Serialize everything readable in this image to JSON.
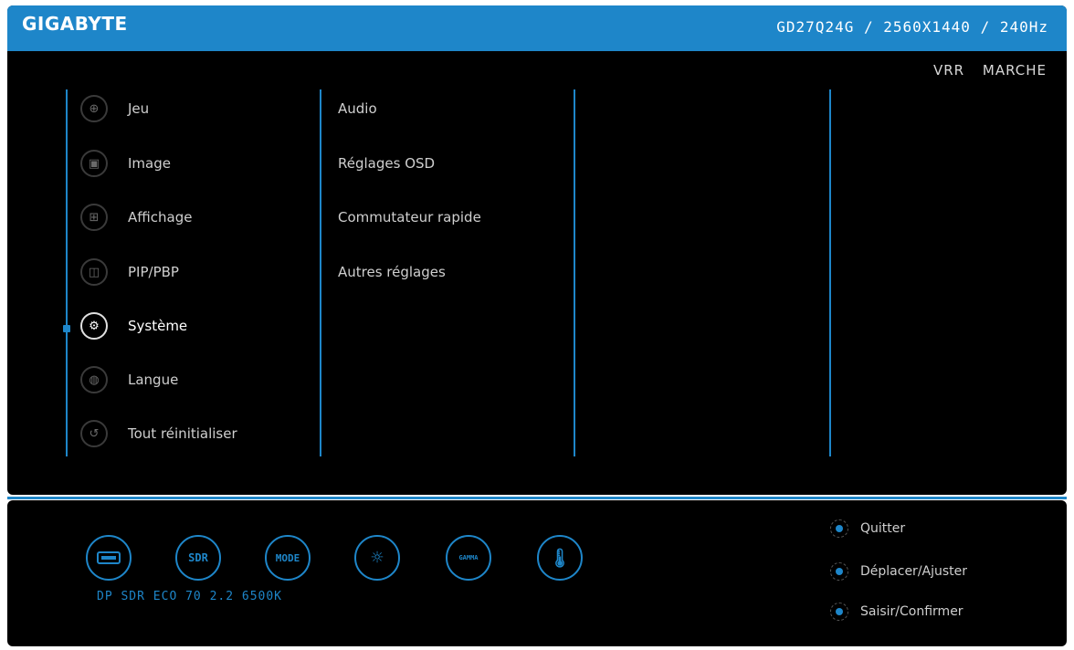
{
  "header": {
    "brand": "GIGABYTE",
    "model_info": "GD27Q24G  /  2560X1440 / 240Hz"
  },
  "vrr": {
    "label": "VRR",
    "value": "MARCHE"
  },
  "main_menu": [
    {
      "label": "Jeu",
      "icon": "gamepad-icon"
    },
    {
      "label": "Image",
      "icon": "image-icon"
    },
    {
      "label": "Affichage",
      "icon": "display-icon"
    },
    {
      "label": "PIP/PBP",
      "icon": "pip-icon"
    },
    {
      "label": "Système",
      "icon": "gear-icon",
      "active": true
    },
    {
      "label": "Langue",
      "icon": "globe-icon"
    },
    {
      "label": "Tout réinitialiser",
      "icon": "reset-icon"
    }
  ],
  "submenu": [
    {
      "label": "Audio"
    },
    {
      "label": "Réglages OSD"
    },
    {
      "label": "Commutateur rapide"
    },
    {
      "label": "Autres réglages"
    }
  ],
  "status_bar": {
    "icons": [
      {
        "name": "input-icon",
        "label": ""
      },
      {
        "name": "sdr-icon",
        "label": "SDR"
      },
      {
        "name": "mode-icon",
        "label": "MODE"
      },
      {
        "name": "brightness-icon",
        "label": ""
      },
      {
        "name": "gamma-icon",
        "label": "GAMMA"
      },
      {
        "name": "temperature-icon",
        "label": ""
      }
    ],
    "text": "DP SDR ECO 70 2.2 6500K"
  },
  "hints": [
    {
      "label": "Quitter",
      "icon": "joystick-left-icon"
    },
    {
      "label": "Déplacer/Ajuster",
      "icon": "joystick-updown-icon"
    },
    {
      "label": "Saisir/Confirmer",
      "icon": "joystick-press-icon"
    }
  ],
  "colors": {
    "accent": "#1e86c9",
    "background": "#000000"
  }
}
